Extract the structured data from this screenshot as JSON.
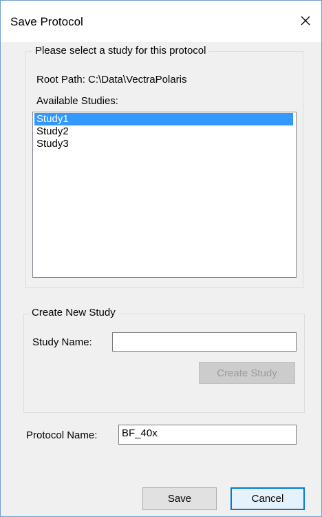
{
  "dialog": {
    "title": "Save Protocol",
    "close_icon": "close-icon"
  },
  "select_study": {
    "legend": "Please select a study for this protocol",
    "root_path": "Root Path: C:\\Data\\VectraPolaris",
    "available_label": "Available Studies:",
    "studies": [
      "Study1",
      "Study2",
      "Study3"
    ],
    "selected": "Study1"
  },
  "create_study": {
    "legend": "Create New Study",
    "name_label": "Study Name:",
    "name_value": "",
    "button_label": "Create Study"
  },
  "protocol": {
    "label": "Protocol Name:",
    "value": "BF_40x"
  },
  "buttons": {
    "save": "Save",
    "cancel": "Cancel"
  },
  "colors": {
    "selection": "#3399ff",
    "default_button_border": "#0078d7",
    "window_border": "#6f9fcf"
  }
}
